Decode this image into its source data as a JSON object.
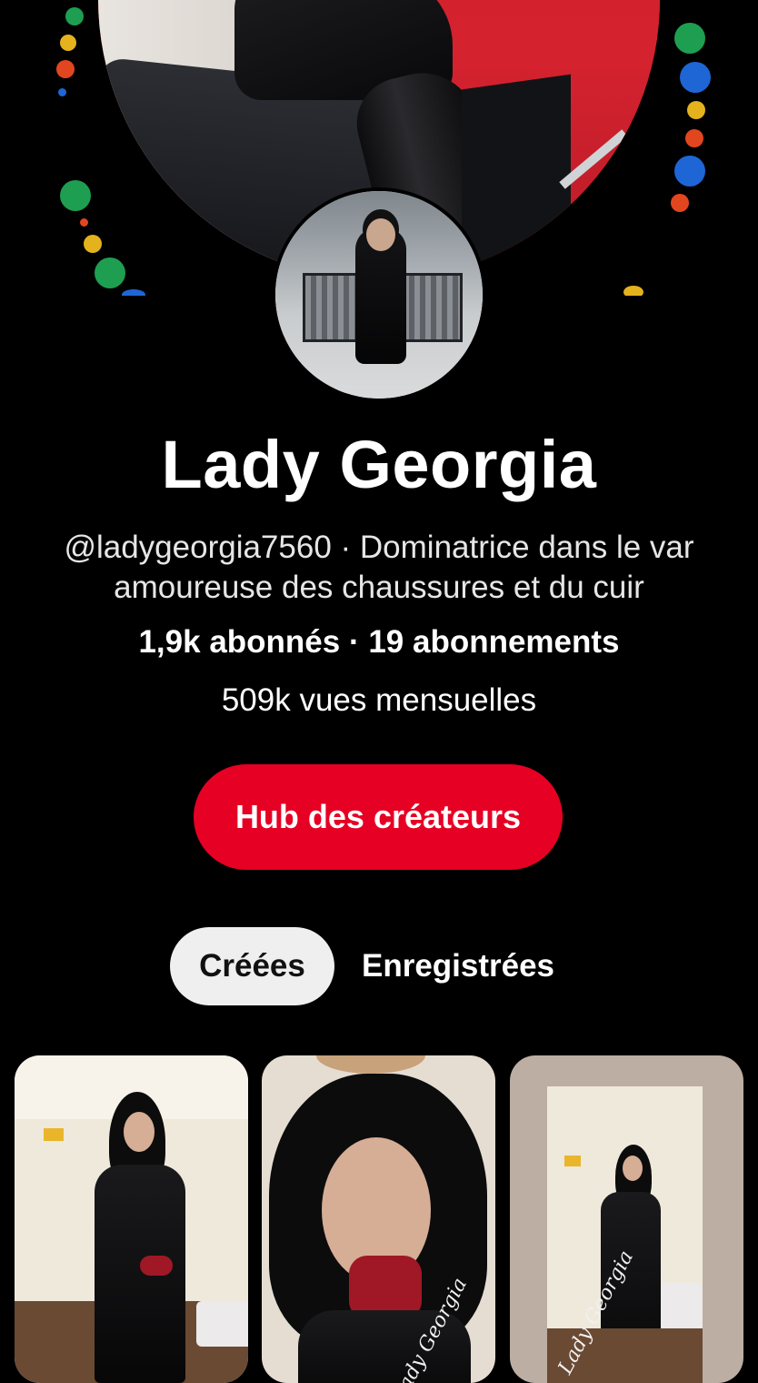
{
  "profile": {
    "name": "Lady Georgia",
    "bio": "@ladygeorgia7560 · Dominatrice dans le var amoureuse des chaussures et du cuir",
    "stats": "1,9k abonnés · 19 abonnements",
    "monthly_views": "509k vues mensuelles"
  },
  "actions": {
    "hub_label": "Hub des créateurs"
  },
  "tabs": [
    {
      "label": "Créées",
      "active": true
    },
    {
      "label": "Enregistrées",
      "active": false
    }
  ],
  "pins": [
    {
      "watermark": ""
    },
    {
      "watermark": "Lady Georgia"
    },
    {
      "watermark": "Lady Georgia"
    }
  ],
  "colors": {
    "background": "#000000",
    "accent": "#e60023",
    "tab_active_bg": "#efefef"
  }
}
